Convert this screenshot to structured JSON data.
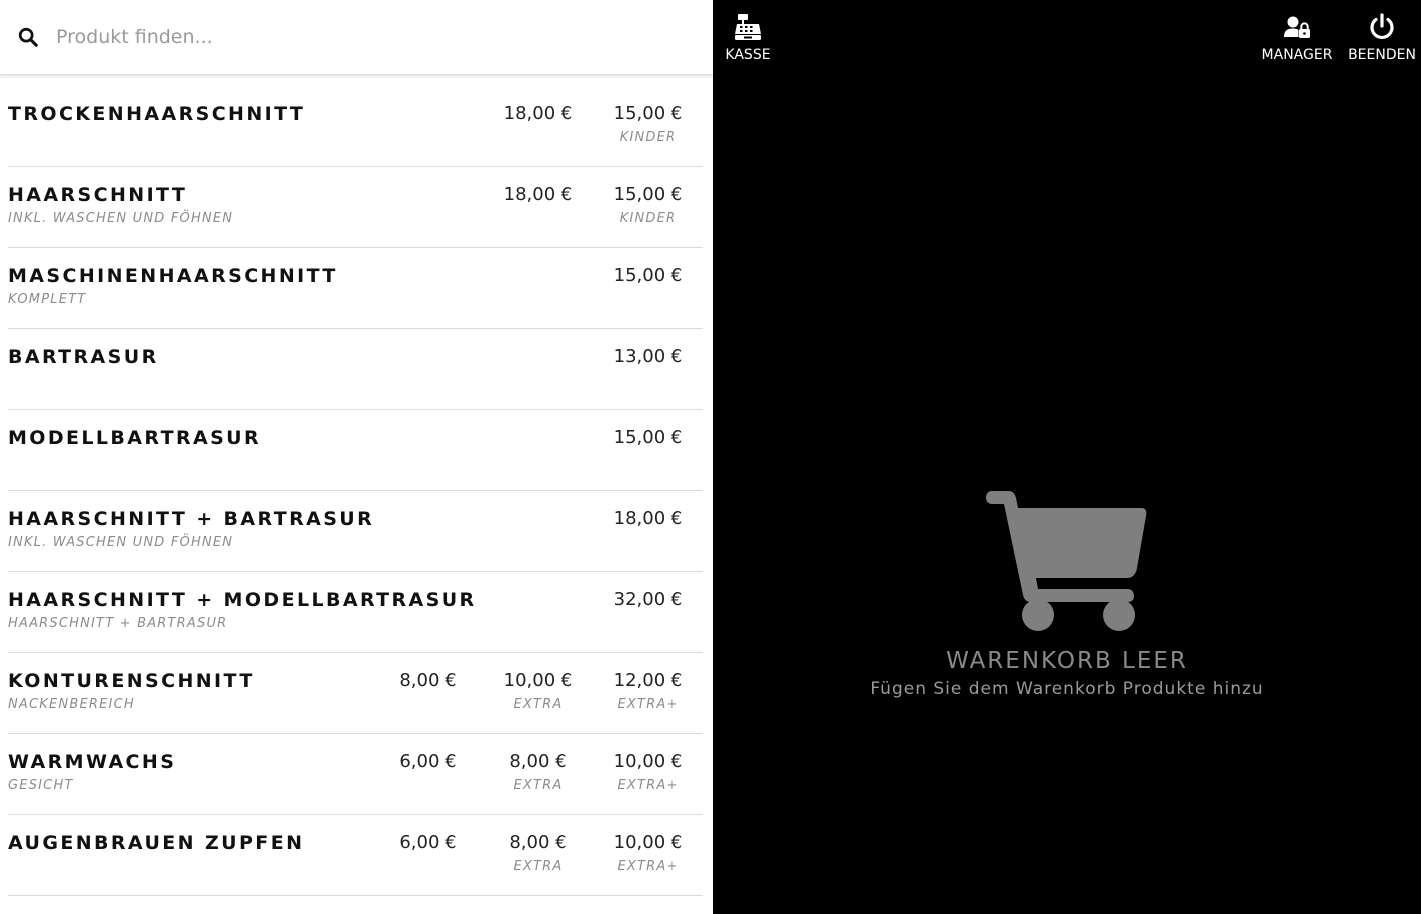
{
  "search": {
    "placeholder": "Produkt finden..."
  },
  "nav": {
    "kasse": "KASSE",
    "manager": "MANAGER",
    "beenden": "BEENDEN"
  },
  "products": [
    {
      "name": "TROCKENHAARSCHNITT",
      "sub": "",
      "prices": [
        {
          "col": 2,
          "amount": "18,00 €",
          "label": ""
        },
        {
          "col": 3,
          "amount": "15,00 €",
          "label": "KINDER"
        }
      ]
    },
    {
      "name": "HAARSCHNITT",
      "sub": "INKL. WASCHEN UND FÖHNEN",
      "prices": [
        {
          "col": 2,
          "amount": "18,00 €",
          "label": ""
        },
        {
          "col": 3,
          "amount": "15,00 €",
          "label": "KINDER"
        }
      ]
    },
    {
      "name": "MASCHINENHAARSCHNITT",
      "sub": "KOMPLETT",
      "prices": [
        {
          "col": 3,
          "amount": "15,00 €",
          "label": ""
        }
      ]
    },
    {
      "name": "BARTRASUR",
      "sub": "",
      "prices": [
        {
          "col": 3,
          "amount": "13,00 €",
          "label": ""
        }
      ]
    },
    {
      "name": "MODELLBARTRASUR",
      "sub": "",
      "prices": [
        {
          "col": 3,
          "amount": "15,00 €",
          "label": ""
        }
      ]
    },
    {
      "name": "HAARSCHNITT + BARTRASUR",
      "sub": "INKL. WASCHEN UND FÖHNEN",
      "prices": [
        {
          "col": 3,
          "amount": "18,00 €",
          "label": ""
        }
      ]
    },
    {
      "name": "HAARSCHNITT + MODELLBARTRASUR",
      "sub": "HAARSCHNITT + BARTRASUR",
      "prices": [
        {
          "col": 3,
          "amount": "32,00 €",
          "label": ""
        }
      ]
    },
    {
      "name": "KONTURENSCHNITT",
      "sub": "NACKENBEREICH",
      "prices": [
        {
          "col": 1,
          "amount": "8,00 €",
          "label": ""
        },
        {
          "col": 2,
          "amount": "10,00 €",
          "label": "EXTRA"
        },
        {
          "col": 3,
          "amount": "12,00 €",
          "label": "EXTRA+"
        }
      ]
    },
    {
      "name": "WARMWACHS",
      "sub": "GESICHT",
      "prices": [
        {
          "col": 1,
          "amount": "6,00 €",
          "label": ""
        },
        {
          "col": 2,
          "amount": "8,00 €",
          "label": "EXTRA"
        },
        {
          "col": 3,
          "amount": "10,00 €",
          "label": "EXTRA+"
        }
      ]
    },
    {
      "name": "AUGENBRAUEN ZUPFEN",
      "sub": "",
      "prices": [
        {
          "col": 1,
          "amount": "6,00 €",
          "label": ""
        },
        {
          "col": 2,
          "amount": "8,00 €",
          "label": "EXTRA"
        },
        {
          "col": 3,
          "amount": "10,00 €",
          "label": "EXTRA+"
        }
      ]
    }
  ],
  "cart": {
    "empty_title": "WARENKORB LEER",
    "empty_hint": "Fügen Sie dem Warenkorb Produkte hinzu"
  },
  "colors": {
    "cart_icon": "#7f7f7f",
    "panel_background": "#000000",
    "list_background": "#ffffff"
  },
  "icons": {
    "search": "search-icon",
    "kasse": "cash-register-icon",
    "manager": "user-lock-icon",
    "beenden": "power-icon",
    "cart": "shopping-cart-icon"
  }
}
